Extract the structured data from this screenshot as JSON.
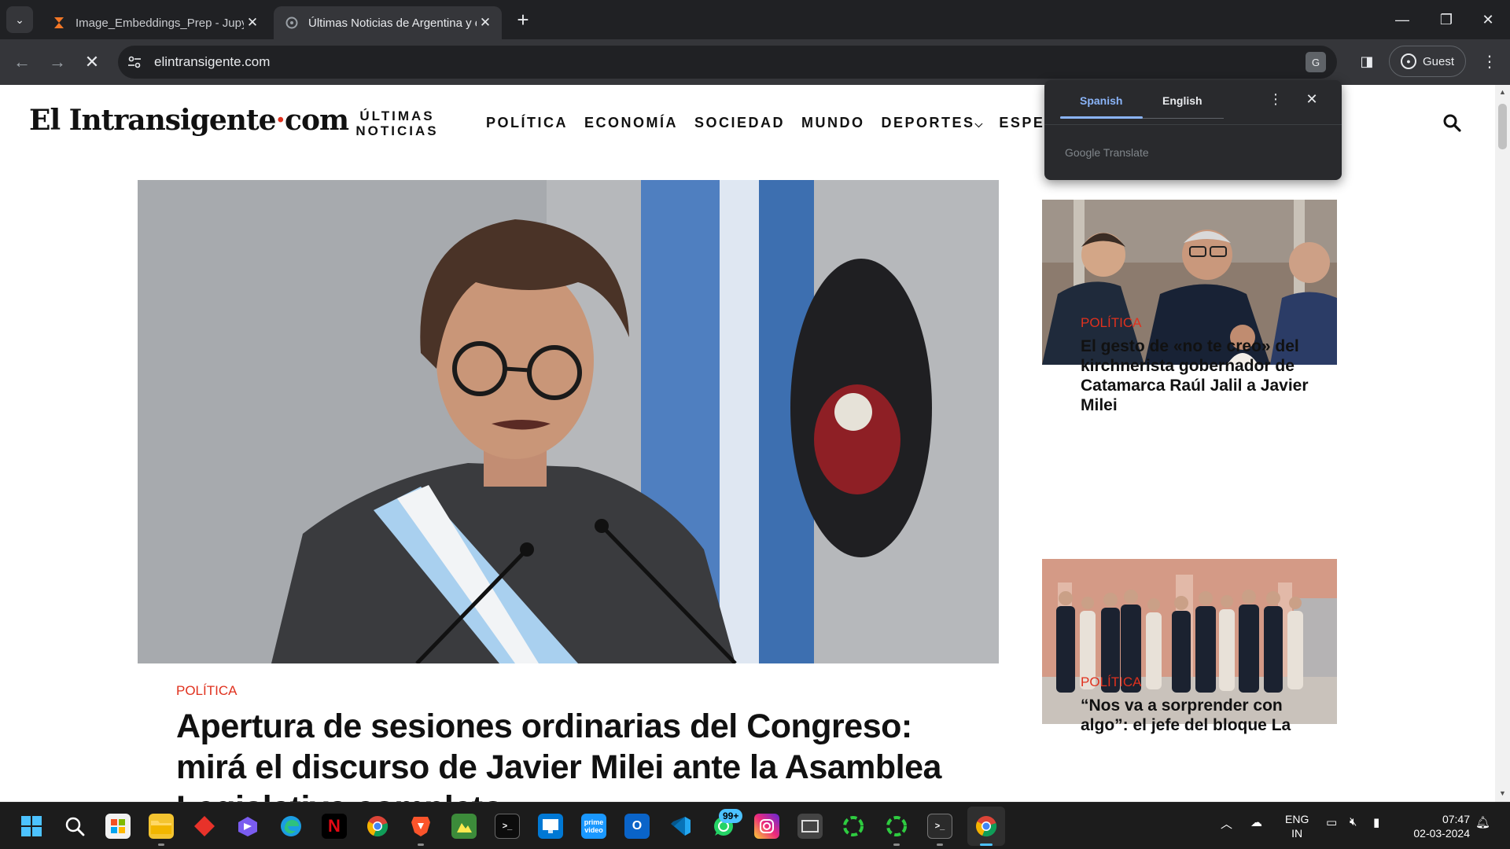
{
  "browser": {
    "tabs": [
      {
        "title": "Image_Embeddings_Prep - Jupyter",
        "icon": "jupyter-icon"
      },
      {
        "title": "Últimas Noticias de Argentina y el Mundo",
        "icon": "site-icon"
      }
    ],
    "url": "elintransigente.com",
    "profile_label": "Guest"
  },
  "translate_popup": {
    "languages": [
      "Spanish",
      "English"
    ],
    "selected": "Spanish",
    "brand": "Google Translate"
  },
  "site": {
    "logo_main": "El Intransigente",
    "logo_dot": "·",
    "logo_suffix": "com",
    "ultimas_line1": "ÚLTIMAS",
    "ultimas_line2": "NOTICIAS",
    "nav": [
      "POLÍTICA",
      "ECONOMÍA",
      "SOCIEDAD",
      "MUNDO",
      "DEPORTES",
      "ESPE"
    ],
    "nav_dropdown_glyph": "⌵"
  },
  "hero": {
    "category": "POLÍTICA",
    "title": "Apertura de sesiones ordinarias del Congreso: mirá el discurso de Javier Milei ante la Asamblea Legislativa completo"
  },
  "side_articles": [
    {
      "category": "POLÍTICA",
      "title": "El gesto de «no te creo» del kirchnerista gobernador de Catamarca Raúl Jalil a Javier Milei"
    },
    {
      "category": "POLÍTICA",
      "title": "“Nos va a sorprender con algo”: el jefe del bloque La"
    }
  ],
  "taskbar": {
    "whatsapp_badge": "99+",
    "lang_line1": "ENG",
    "lang_line2": "IN",
    "time": "07:47",
    "date": "02-03-2024"
  },
  "colors": {
    "accent_red": "#e0311e",
    "chrome_dark": "#202124",
    "translate_blue": "#8ab4f8"
  }
}
